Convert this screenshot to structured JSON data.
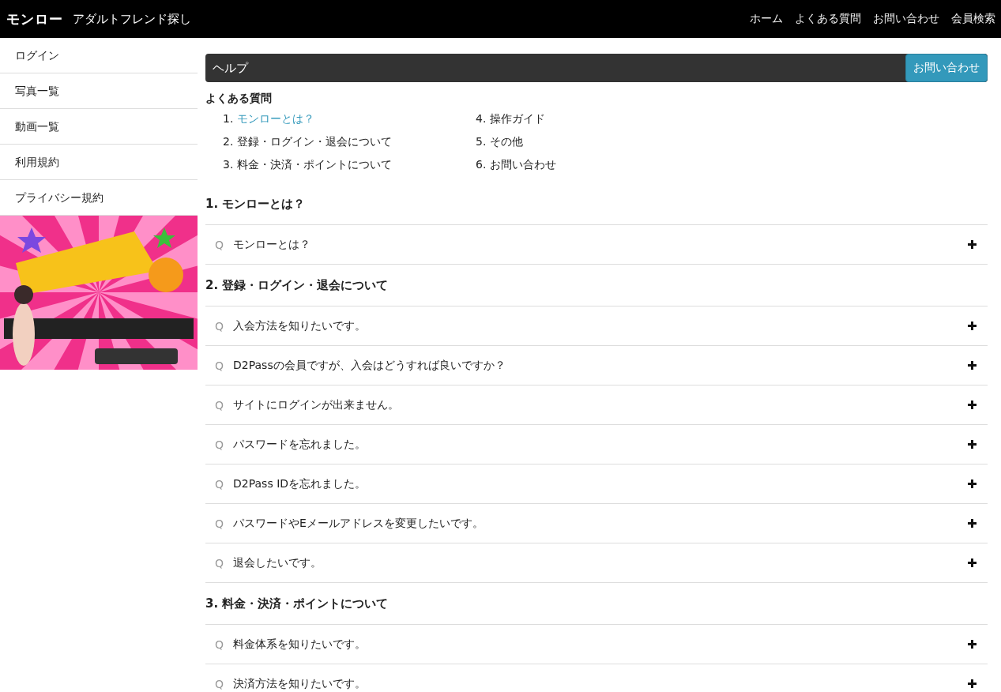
{
  "header": {
    "logo": "モンロー",
    "site_name": "アダルトフレンド探し",
    "nav": [
      "ホーム",
      "よくある質問",
      "お問い合わせ",
      "会員検索"
    ]
  },
  "sidebar": {
    "items": [
      "ログイン",
      "写真一覧",
      "動画一覧",
      "利用規約",
      "プライバシー規約"
    ],
    "banner": {
      "kind": "picture"
    }
  },
  "help_bar": {
    "title": "ヘルプ",
    "button": "お問い合わせ"
  },
  "faq_index": {
    "title": "よくある質問",
    "items": [
      {
        "number": "1.",
        "label": "モンローとは？",
        "active": true
      },
      {
        "number": "2.",
        "label": "登録・ログイン・退会について",
        "active": false
      },
      {
        "number": "3.",
        "label": "料金・決済・ポイントについて",
        "active": false
      },
      {
        "number": "4.",
        "label": "操作ガイド",
        "active": false
      },
      {
        "number": "5.",
        "label": "その他",
        "active": false
      },
      {
        "number": "6.",
        "label": "お問い合わせ",
        "active": false
      }
    ]
  },
  "sections": [
    {
      "title": "1. モンローとは？",
      "questions": [
        {
          "q": "Q",
          "text": "モンローとは？"
        }
      ]
    },
    {
      "title": "2. 登録・ログイン・退会について",
      "questions": [
        {
          "q": "Q",
          "text": "入会方法を知りたいです。"
        },
        {
          "q": "Q",
          "text": "D2Passの会員ですが、入会はどうすれば良いですか？"
        },
        {
          "q": "Q",
          "text": "サイトにログインが出来ません。"
        },
        {
          "q": "Q",
          "text": "パスワードを忘れました。"
        },
        {
          "q": "Q",
          "text": "D2Pass IDを忘れました。"
        },
        {
          "q": "Q",
          "text": "パスワードやEメールアドレスを変更したいです。"
        },
        {
          "q": "Q",
          "text": "退会したいです。"
        }
      ]
    },
    {
      "title": "3. 料金・決済・ポイントについて",
      "questions": [
        {
          "q": "Q",
          "text": "料金体系を知りたいです。"
        },
        {
          "q": "Q",
          "text": "決済方法を知りたいです。"
        }
      ]
    }
  ]
}
